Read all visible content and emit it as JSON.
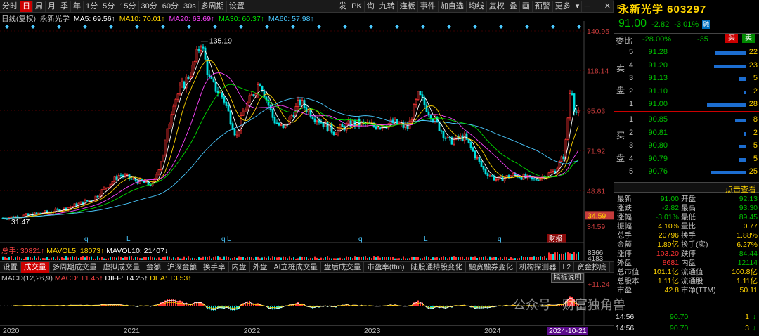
{
  "toolbar": {
    "left": [
      "分时",
      "日",
      "周",
      "月",
      "季",
      "年",
      "1分",
      "5分",
      "15分",
      "30分",
      "60分",
      "30s",
      "多周期",
      "设置"
    ],
    "selected": "日",
    "right": [
      "发",
      "PK",
      "询",
      "九转",
      "连板",
      "事件",
      "加自选",
      "均线",
      "复权",
      "叠",
      "画",
      "预警",
      "更多"
    ]
  },
  "ma_legend": {
    "period": "日线(复权)",
    "name": "永新光学",
    "ma5": "MA5: 69.56↑",
    "ma10": "MA10: 70.01↑",
    "ma20": "MA20: 63.69↑",
    "ma30": "MA30: 60.37↑",
    "ma60": "MA60: 57.98↑"
  },
  "colors": {
    "ma5": "#ffffff",
    "ma10": "#ffd400",
    "ma20": "#ff44ff",
    "ma30": "#00e000",
    "ma60": "#4ac9ff",
    "up": "#ff3333",
    "down": "#00e0e0"
  },
  "chart_data": {
    "type": "candlestick",
    "y_labels": [
      "140.95",
      "118.14",
      "95.03",
      "71.92",
      "48.81",
      "34.59"
    ],
    "y_ticks": [
      140.95,
      118.14,
      95.03,
      71.92,
      48.81
    ],
    "ylim": [
      25,
      145
    ],
    "high_label": "135.19",
    "low_label": "31.47",
    "current_price_label": "34.59",
    "event_label": "财报",
    "x_labels": [
      "2020",
      "2021",
      "2022",
      "2023",
      "2024",
      "2024-10-21"
    ],
    "x_label_years": [
      2020,
      2021,
      2022,
      2023,
      2024
    ],
    "x_range": [
      "2020-01-01",
      "2024-10-21"
    ],
    "trend": [
      [
        "2020-01-01",
        33
      ],
      [
        "2020-04-01",
        35
      ],
      [
        "2020-07-01",
        38
      ],
      [
        "2020-10-01",
        44
      ],
      [
        "2020-12-20",
        58
      ],
      [
        "2021-02-01",
        55
      ],
      [
        "2021-04-01",
        52
      ],
      [
        "2021-05-01",
        70
      ],
      [
        "2021-06-01",
        100
      ],
      [
        "2021-08-01",
        120
      ],
      [
        "2021-08-24",
        135
      ],
      [
        "2021-09-20",
        112
      ],
      [
        "2021-11-01",
        102
      ],
      [
        "2021-12-10",
        80
      ],
      [
        "2022-01-01",
        95
      ],
      [
        "2022-02-20",
        112
      ],
      [
        "2022-04-01",
        90
      ],
      [
        "2022-05-01",
        84
      ],
      [
        "2022-06-20",
        100
      ],
      [
        "2022-08-01",
        92
      ],
      [
        "2022-10-01",
        83
      ],
      [
        "2022-12-01",
        88
      ],
      [
        "2023-02-01",
        86
      ],
      [
        "2023-04-01",
        88
      ],
      [
        "2023-05-15",
        85
      ],
      [
        "2023-06-15",
        104
      ],
      [
        "2023-08-01",
        90
      ],
      [
        "2023-09-15",
        77
      ],
      [
        "2023-11-01",
        80
      ],
      [
        "2024-01-01",
        60
      ],
      [
        "2024-02-08",
        55
      ],
      [
        "2024-04-01",
        58
      ],
      [
        "2024-06-01",
        55
      ],
      [
        "2024-08-01",
        60
      ],
      [
        "2024-09-01",
        70
      ],
      [
        "2024-09-20",
        112
      ],
      [
        "2024-10-01",
        95
      ],
      [
        "2024-10-21",
        91
      ]
    ],
    "volume_legend": [
      "总手: 30821↑",
      "MAVOL5: 18073↑",
      "MAVOL10: 21407↓"
    ],
    "volume_ticks": [
      "8366",
      "4183"
    ],
    "macd_legend": {
      "title": "MACD(12,26,9)",
      "macd": "MACD: +1.45↑",
      "diff": "DIFF: +4.25↑",
      "dea": "DEA: +3.53↑"
    },
    "macd_tick": "+11.24"
  },
  "macd_button": "指标说明",
  "tabs": [
    "设置",
    "成交量",
    "多周期成交量",
    "虚拟成交量",
    "金额",
    "沪深金额",
    "换手率",
    "内盘",
    "外盘",
    "AI立桩成交量",
    "盘后成交量",
    "市盈率(ttm)",
    "陆股通持股变化",
    "融资融券变化",
    "机构探测器",
    "L2",
    "资金抄底"
  ],
  "tab_selected": "成交量",
  "panel": {
    "code_prefix": "R",
    "title": "永新光学 603297",
    "price": "91.00",
    "change": "-2.82",
    "pct": "-3.01%",
    "margin_badge": "融",
    "weibi_label": "委比",
    "weibi": "-28.00%",
    "weicha": "-35",
    "buy_label": "买",
    "sell_label": "卖",
    "sell_side_label": [
      "卖",
      "盘"
    ],
    "buy_side_label": [
      "买",
      "盘"
    ],
    "asks": [
      {
        "lvl": "5",
        "px": "91.28",
        "vol": "22"
      },
      {
        "lvl": "4",
        "px": "91.20",
        "vol": "23"
      },
      {
        "lvl": "3",
        "px": "91.13",
        "vol": "5"
      },
      {
        "lvl": "2",
        "px": "91.10",
        "vol": "2"
      },
      {
        "lvl": "1",
        "px": "91.00",
        "vol": "28"
      }
    ],
    "bids": [
      {
        "lvl": "1",
        "px": "90.85",
        "vol": "8"
      },
      {
        "lvl": "2",
        "px": "90.81",
        "vol": "2"
      },
      {
        "lvl": "3",
        "px": "90.80",
        "vol": "5"
      },
      {
        "lvl": "4",
        "px": "90.79",
        "vol": "5"
      },
      {
        "lvl": "5",
        "px": "90.76",
        "vol": "25"
      }
    ],
    "click_view": "点击查看",
    "stats": [
      {
        "k1": "最新",
        "v1": "91.00",
        "c1": "grn",
        "k2": "开盘",
        "v2": "92.13",
        "c2": "grn"
      },
      {
        "k1": "涨跌",
        "v1": "-2.82",
        "c1": "grn",
        "k2": "最高",
        "v2": "93.30",
        "c2": "grn"
      },
      {
        "k1": "涨幅",
        "v1": "-3.01%",
        "c1": "grn",
        "k2": "最低",
        "v2": "89.45",
        "c2": "grn"
      },
      {
        "k1": "振幅",
        "v1": "4.10%",
        "c1": "yel",
        "k2": "量比",
        "v2": "0.77",
        "c2": "yel"
      },
      {
        "k1": "总手",
        "v1": "20796",
        "c1": "yel",
        "k2": "换手",
        "v2": "1.88%",
        "c2": "yel"
      },
      {
        "k1": "金额",
        "v1": "1.89亿",
        "c1": "yel",
        "k2": "换手(实)",
        "v2": "6.27%",
        "c2": "yel"
      },
      {
        "k1": "涨停",
        "v1": "103.20",
        "c1": "red",
        "k2": "跌停",
        "v2": "84.44",
        "c2": "grn"
      },
      {
        "k1": "外盘",
        "v1": "8681",
        "c1": "red",
        "k2": "内盘",
        "v2": "12114",
        "c2": "grn"
      },
      {
        "k1": "总市值",
        "v1": "101.1亿",
        "c1": "yel",
        "k2": "流通值",
        "v2": "100.8亿",
        "c2": "yel"
      },
      {
        "k1": "总股本",
        "v1": "1.11亿",
        "c1": "yel",
        "k2": "流通股",
        "v2": "1.11亿",
        "c2": "yel"
      },
      {
        "k1": "市盈",
        "v1": "42.8",
        "c1": "yel",
        "k2": "市净(TTM)",
        "v2": "50.11",
        "c2": "yel"
      }
    ],
    "ticks": [
      {
        "time": "14:56",
        "px": "90.70",
        "vol": "1",
        "arrow": "↓"
      },
      {
        "time": "14:56",
        "px": "90.70",
        "vol": "3",
        "arrow": "↓"
      }
    ]
  },
  "watermark": "公众号 · 财富独角兽"
}
